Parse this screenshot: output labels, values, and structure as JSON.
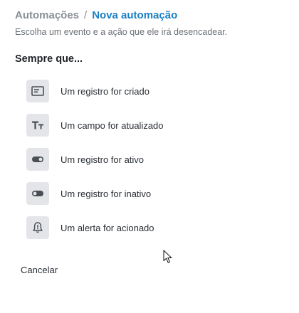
{
  "breadcrumb": {
    "parent": "Automações",
    "separator": "/",
    "current": "Nova automação"
  },
  "subtitle": "Escolha um evento e a ação que ele irá desencadear.",
  "section_title": "Sempre que...",
  "options": [
    {
      "icon": "form-icon",
      "label": "Um registro for criado"
    },
    {
      "icon": "text-field-icon",
      "label": "Um campo for atualizado"
    },
    {
      "icon": "toggle-on-icon",
      "label": "Um registro for ativo"
    },
    {
      "icon": "toggle-off-icon",
      "label": "Um registro for inativo"
    },
    {
      "icon": "alert-bell-icon",
      "label": "Um alerta for acionado"
    }
  ],
  "cancel_label": "Cancelar",
  "colors": {
    "accent": "#1b7fc4",
    "muted_text": "#8a8f95",
    "icon_tile": "#e3e5e8",
    "icon_glyph": "#4a4f55"
  }
}
